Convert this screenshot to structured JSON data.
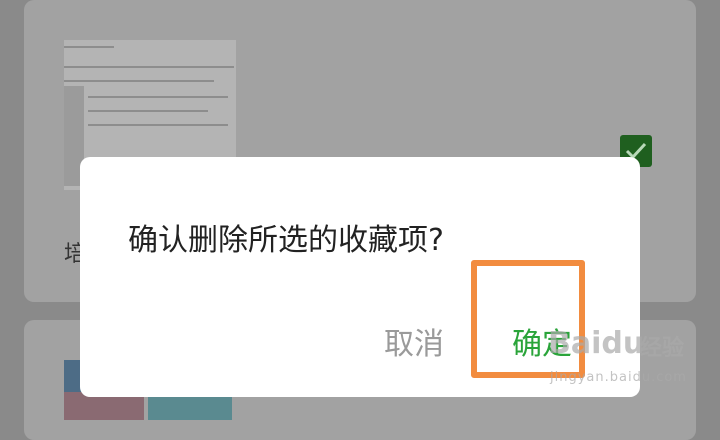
{
  "background_list": {
    "card1": {
      "title_fragment": "培"
    },
    "card2": {}
  },
  "dialog": {
    "message": "确认删除所选的收藏项?",
    "cancel_label": "取消",
    "confirm_label": "确定"
  },
  "watermark": {
    "logo": "Baidu",
    "text": "经验",
    "url": "jingyan.baidu.com"
  },
  "colors": {
    "confirm": "#2aa43a",
    "cancel": "#9a9a9a",
    "highlight": "#f28c3f",
    "checkbox": "#1f5f1f"
  },
  "icons": {
    "checkbox": "check-icon"
  }
}
